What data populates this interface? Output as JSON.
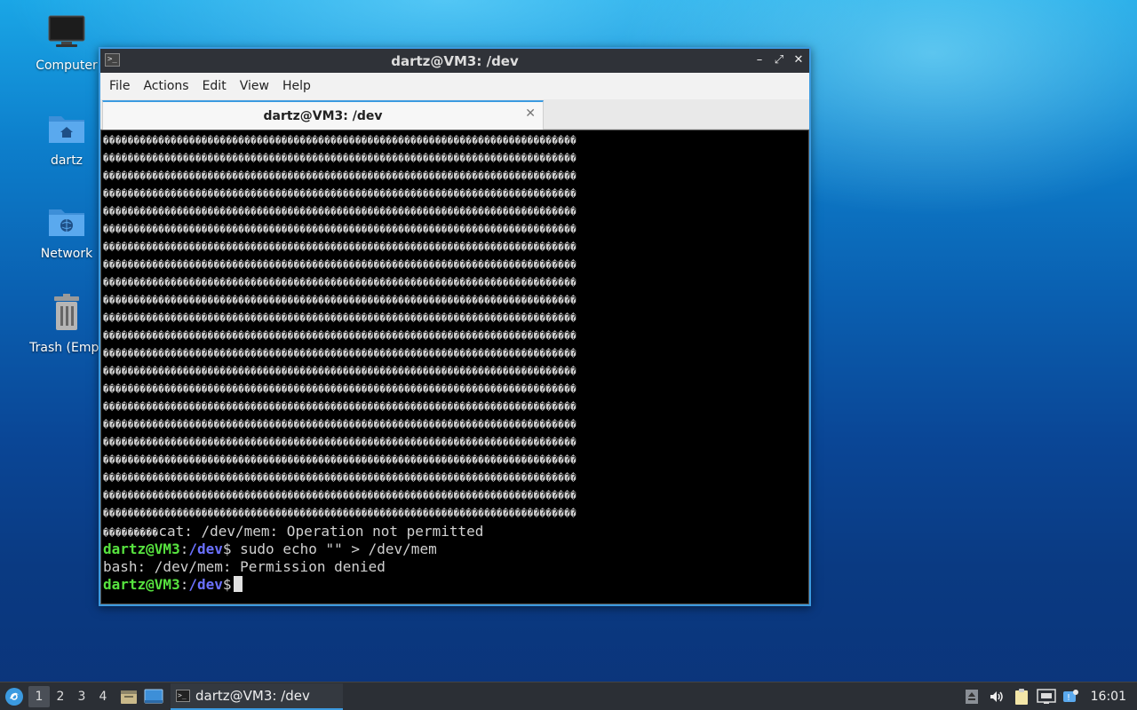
{
  "desktop": {
    "icons": [
      {
        "label": "Computer"
      },
      {
        "label": "dartz"
      },
      {
        "label": "Network"
      },
      {
        "label": "Trash (Empt"
      }
    ]
  },
  "window": {
    "title": "dartz@VM3: /dev",
    "menu": [
      "File",
      "Actions",
      "Edit",
      "View",
      "Help"
    ],
    "tab_label": "dartz@VM3: /dev",
    "terminal": {
      "garbage_char": "�",
      "garbage_line_count": 22,
      "garbage_line_length": 77,
      "tail_garbage": "���������",
      "line_cat_error": "cat: /dev/mem: Operation not permitted",
      "prompt_user": "dartz@VM3",
      "prompt_sep": ":",
      "prompt_path": "/dev",
      "prompt_end": "$",
      "cmd_1": " sudo echo \"\" > /dev/mem",
      "line_bash_error": "bash: /dev/mem: Permission denied"
    }
  },
  "taskbar": {
    "workspaces": [
      "1",
      "2",
      "3",
      "4"
    ],
    "task_label": "dartz@VM3: /dev",
    "clock": "16:01"
  },
  "colors": {
    "accent": "#3b9ae0",
    "prompt_green": "#57e33f",
    "prompt_blue": "#6b71ff"
  }
}
